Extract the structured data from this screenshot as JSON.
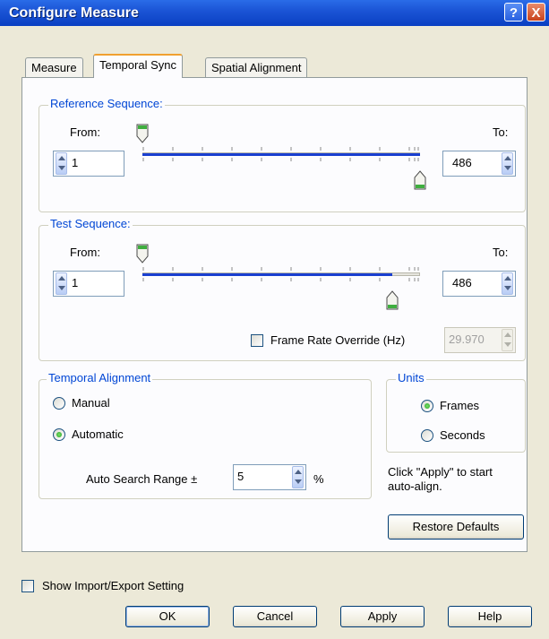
{
  "window": {
    "title": "Configure Measure",
    "help_symbol": "?",
    "close_symbol": "X"
  },
  "tabs": [
    {
      "label": "Measure"
    },
    {
      "label": "Temporal Sync"
    },
    {
      "label": "Spatial Alignment"
    }
  ],
  "reference_sequence": {
    "legend": "Reference Sequence:",
    "from_label": "From:",
    "to_label": "To:",
    "from_value": "1",
    "to_value": "486",
    "range_fraction": [
      0.0,
      1.0
    ]
  },
  "test_sequence": {
    "legend": "Test Sequence:",
    "from_label": "From:",
    "to_label": "To:",
    "from_value": "1",
    "to_value": "486",
    "range_fraction": [
      0.0,
      0.9
    ]
  },
  "frame_rate_override": {
    "label": "Frame Rate Override (Hz)",
    "checked": false,
    "value": "29.970"
  },
  "temporal_alignment": {
    "legend": "Temporal Alignment",
    "manual_label": "Manual",
    "automatic_label": "Automatic",
    "selected": "Automatic",
    "search_range_label": "Auto Search Range ±",
    "search_range_value": "5",
    "search_range_unit": "%"
  },
  "units": {
    "legend": "Units",
    "frames_label": "Frames",
    "seconds_label": "Seconds",
    "selected": "Frames"
  },
  "apply_hint": "Click \"Apply\" to start auto-align.",
  "restore_defaults_label": "Restore Defaults",
  "show_import_export_label": "Show Import/Export Setting",
  "buttons": {
    "ok": "OK",
    "cancel": "Cancel",
    "apply": "Apply",
    "help": "Help"
  },
  "icons": {
    "slider_start_thumb": "down-pointer-thumb-icon",
    "slider_end_thumb": "up-pointer-thumb-icon",
    "help": "question-mark-icon",
    "close": "close-x-icon"
  }
}
